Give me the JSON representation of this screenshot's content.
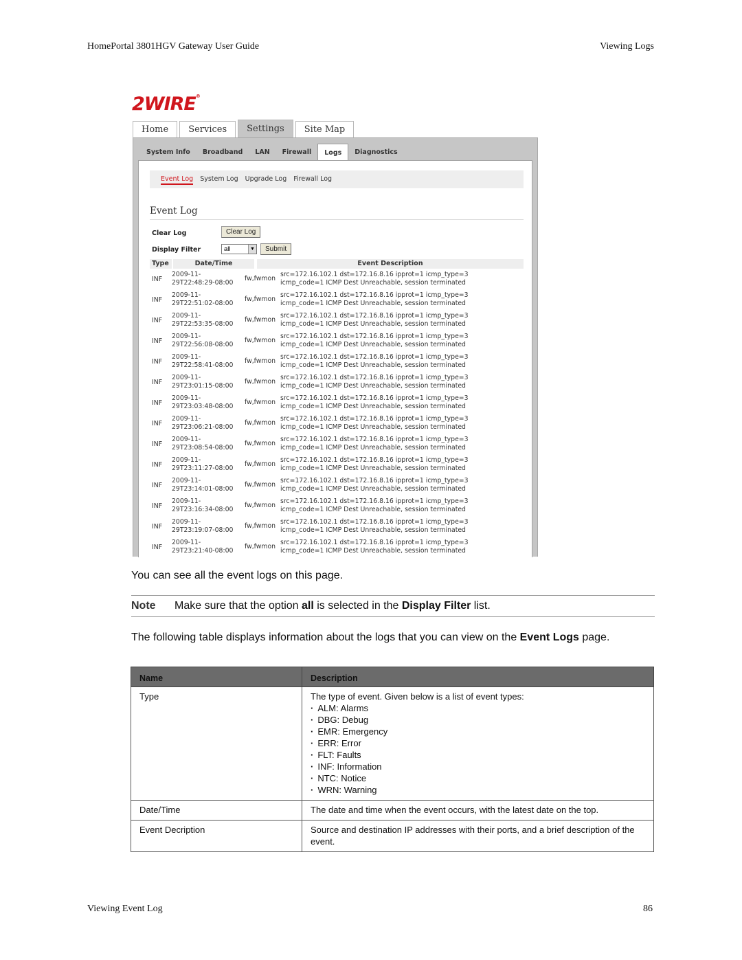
{
  "page_header": {
    "left": "HomePortal 3801HGV Gateway User Guide",
    "right": "Viewing Logs"
  },
  "page_footer": {
    "left": "Viewing Event Log",
    "right": "86"
  },
  "screenshot": {
    "logo": "2WIRE",
    "logo_mark": "®",
    "brand_color": "#d0161d",
    "main_tabs": [
      {
        "label": "Home",
        "active": false
      },
      {
        "label": "Services",
        "active": false
      },
      {
        "label": "Settings",
        "active": true
      },
      {
        "label": "Site Map",
        "active": false
      }
    ],
    "sub_tabs": [
      {
        "label": "System Info",
        "active": false
      },
      {
        "label": "Broadband",
        "active": false
      },
      {
        "label": "LAN",
        "active": false
      },
      {
        "label": "Firewall",
        "active": false
      },
      {
        "label": "Logs",
        "active": true
      },
      {
        "label": "Diagnostics",
        "active": false
      }
    ],
    "log_links": [
      {
        "label": "Event Log",
        "active": true
      },
      {
        "label": "System Log",
        "active": false
      },
      {
        "label": "Upgrade Log",
        "active": false
      },
      {
        "label": "Firewall Log",
        "active": false
      }
    ],
    "section_title": "Event Log",
    "clear_log_label": "Clear Log",
    "clear_log_button": "Clear Log",
    "display_filter_label": "Display Filter",
    "display_filter_value": "all",
    "submit_button": "Submit",
    "table_headers": {
      "type": "Type",
      "datetime": "Date/Time",
      "description": "Event Description"
    },
    "rows": [
      {
        "type": "INF",
        "date": "2009-11-",
        "time": "29T22:48:29-08:00",
        "source": "fw,fwmon",
        "desc1": "src=172.16.102.1 dst=172.16.8.16 ipprot=1 icmp_type=3",
        "desc2": "icmp_code=1 ICMP Dest Unreachable, session terminated"
      },
      {
        "type": "INF",
        "date": "2009-11-",
        "time": "29T22:51:02-08:00",
        "source": "fw,fwmon",
        "desc1": "src=172.16.102.1 dst=172.16.8.16 ipprot=1 icmp_type=3",
        "desc2": "icmp_code=1 ICMP Dest Unreachable, session terminated"
      },
      {
        "type": "INF",
        "date": "2009-11-",
        "time": "29T22:53:35-08:00",
        "source": "fw,fwmon",
        "desc1": "src=172.16.102.1 dst=172.16.8.16 ipprot=1 icmp_type=3",
        "desc2": "icmp_code=1 ICMP Dest Unreachable, session terminated"
      },
      {
        "type": "INF",
        "date": "2009-11-",
        "time": "29T22:56:08-08:00",
        "source": "fw,fwmon",
        "desc1": "src=172.16.102.1 dst=172.16.8.16 ipprot=1 icmp_type=3",
        "desc2": "icmp_code=1 ICMP Dest Unreachable, session terminated"
      },
      {
        "type": "INF",
        "date": "2009-11-",
        "time": "29T22:58:41-08:00",
        "source": "fw,fwmon",
        "desc1": "src=172.16.102.1 dst=172.16.8.16 ipprot=1 icmp_type=3",
        "desc2": "icmp_code=1 ICMP Dest Unreachable, session terminated"
      },
      {
        "type": "INF",
        "date": "2009-11-",
        "time": "29T23:01:15-08:00",
        "source": "fw,fwmon",
        "desc1": "src=172.16.102.1 dst=172.16.8.16 ipprot=1 icmp_type=3",
        "desc2": "icmp_code=1 ICMP Dest Unreachable, session terminated"
      },
      {
        "type": "INF",
        "date": "2009-11-",
        "time": "29T23:03:48-08:00",
        "source": "fw,fwmon",
        "desc1": "src=172.16.102.1 dst=172.16.8.16 ipprot=1 icmp_type=3",
        "desc2": "icmp_code=1 ICMP Dest Unreachable, session terminated"
      },
      {
        "type": "INF",
        "date": "2009-11-",
        "time": "29T23:06:21-08:00",
        "source": "fw,fwmon",
        "desc1": "src=172.16.102.1 dst=172.16.8.16 ipprot=1 icmp_type=3",
        "desc2": "icmp_code=1 ICMP Dest Unreachable, session terminated"
      },
      {
        "type": "INF",
        "date": "2009-11-",
        "time": "29T23:08:54-08:00",
        "source": "fw,fwmon",
        "desc1": "src=172.16.102.1 dst=172.16.8.16 ipprot=1 icmp_type=3",
        "desc2": "icmp_code=1 ICMP Dest Unreachable, session terminated"
      },
      {
        "type": "INF",
        "date": "2009-11-",
        "time": "29T23:11:27-08:00",
        "source": "fw,fwmon",
        "desc1": "src=172.16.102.1 dst=172.16.8.16 ipprot=1 icmp_type=3",
        "desc2": "icmp_code=1 ICMP Dest Unreachable, session terminated"
      },
      {
        "type": "INF",
        "date": "2009-11-",
        "time": "29T23:14:01-08:00",
        "source": "fw,fwmon",
        "desc1": "src=172.16.102.1 dst=172.16.8.16 ipprot=1 icmp_type=3",
        "desc2": "icmp_code=1 ICMP Dest Unreachable, session terminated"
      },
      {
        "type": "INF",
        "date": "2009-11-",
        "time": "29T23:16:34-08:00",
        "source": "fw,fwmon",
        "desc1": "src=172.16.102.1 dst=172.16.8.16 ipprot=1 icmp_type=3",
        "desc2": "icmp_code=1 ICMP Dest Unreachable, session terminated"
      },
      {
        "type": "INF",
        "date": "2009-11-",
        "time": "29T23:19:07-08:00",
        "source": "fw,fwmon",
        "desc1": "src=172.16.102.1 dst=172.16.8.16 ipprot=1 icmp_type=3",
        "desc2": "icmp_code=1 ICMP Dest Unreachable, session terminated"
      },
      {
        "type": "INF",
        "date": "2009-11-",
        "time": "29T23:21:40-08:00",
        "source": "fw,fwmon",
        "desc1": "src=172.16.102.1 dst=172.16.8.16 ipprot=1 icmp_type=3",
        "desc2": "icmp_code=1 ICMP Dest Unreachable, session terminated"
      }
    ]
  },
  "body": {
    "intro": "You can see all the event logs on this page.",
    "note": {
      "label": "Note",
      "pre": "Make sure that the option ",
      "bold1": "all",
      "mid": " is selected in the ",
      "bold2": "Display Filter",
      "post": " list."
    },
    "table_intro": {
      "pre": "The following table displays information about the logs that you can view on the ",
      "bold": "Event Logs",
      "post": " page."
    }
  },
  "ref_table": {
    "headers": {
      "name": "Name",
      "description": "Description"
    },
    "rows": [
      {
        "name": "Type",
        "description": "The type of event. Given below is a list of event types:",
        "bullets": [
          "ALM: Alarms",
          "DBG: Debug",
          "EMR: Emergency",
          "ERR: Error",
          "FLT: Faults",
          "INF: Information",
          "NTC: Notice",
          "WRN: Warning"
        ]
      },
      {
        "name": "Date/Time",
        "description": "The date and time when the event occurs, with the latest date on the top."
      },
      {
        "name": "Event Decription",
        "description": "Source and destination IP addresses with their ports, and a brief description of the event."
      }
    ]
  }
}
